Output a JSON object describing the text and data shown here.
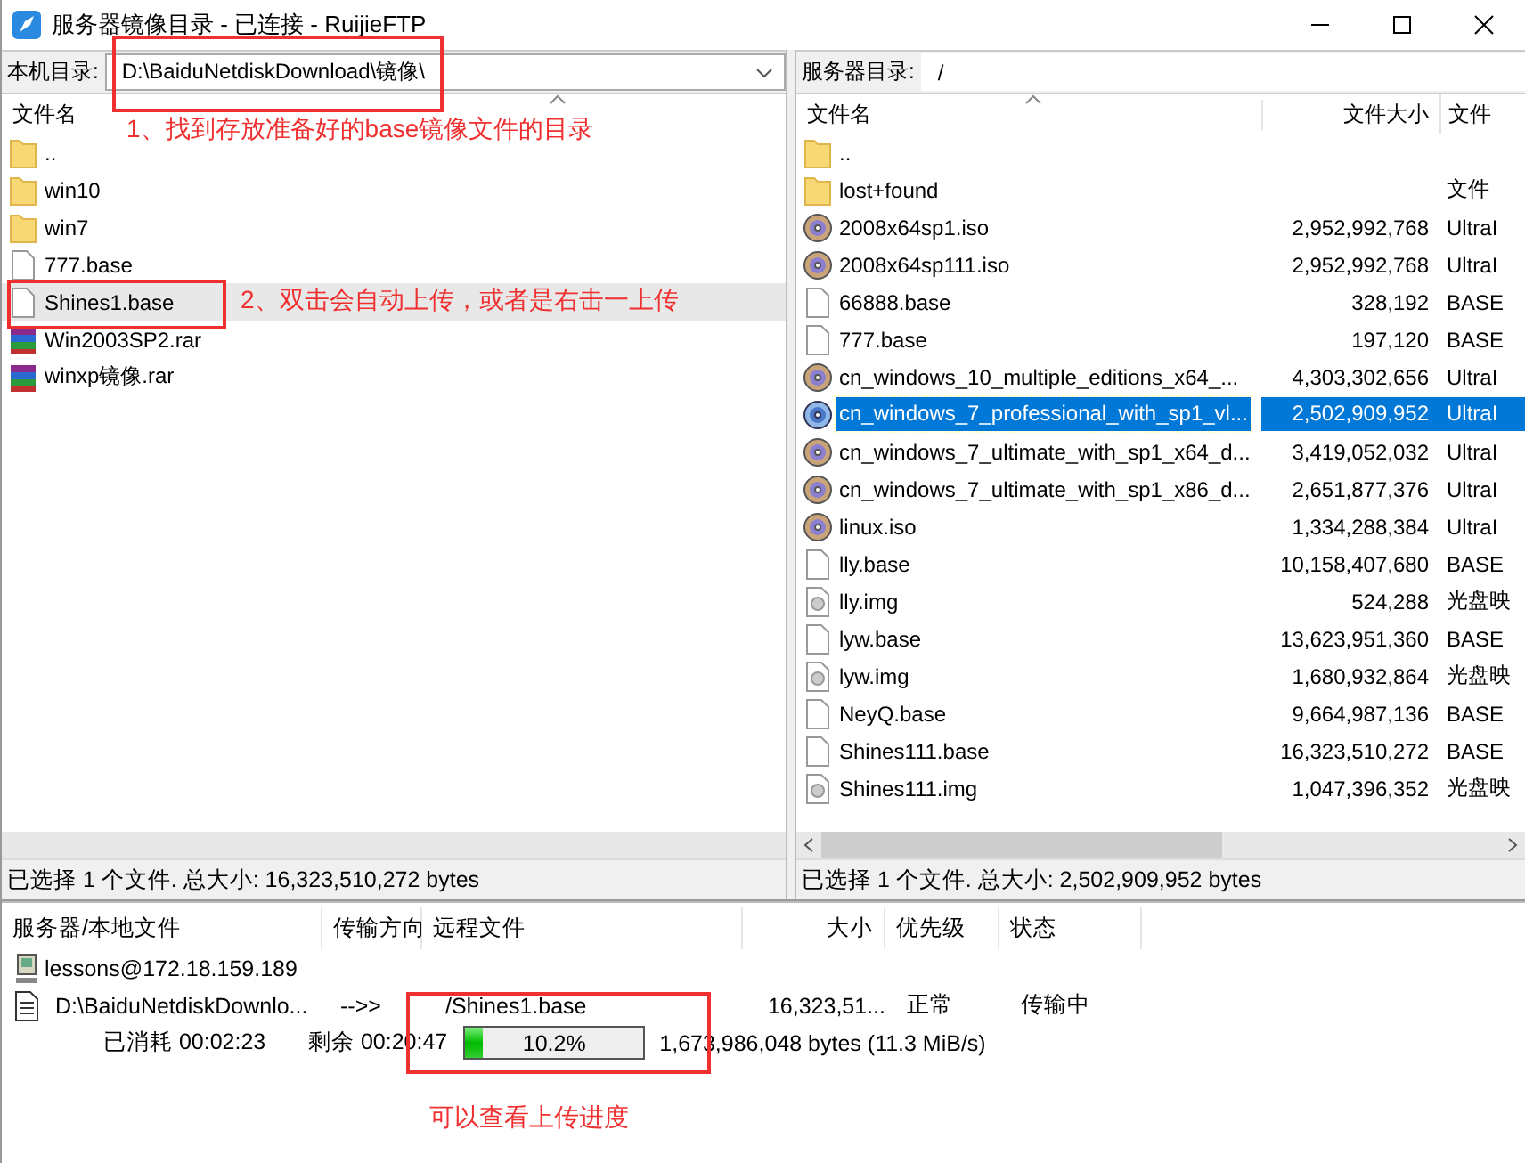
{
  "window": {
    "title": "服务器镜像目录 - 已连接 - RuijieFTP"
  },
  "local": {
    "path_label": "本机目录:",
    "path": "D:\\BaiduNetdiskDownload\\镜像\\",
    "columns": [
      "文件名"
    ],
    "files": [
      {
        "name": "..",
        "kind": "folder",
        "selected": false
      },
      {
        "name": "win10",
        "kind": "folder",
        "selected": false
      },
      {
        "name": "win7",
        "kind": "folder",
        "selected": false
      },
      {
        "name": "777.base",
        "kind": "file",
        "selected": false
      },
      {
        "name": "Shines1.base",
        "kind": "file",
        "selected": true
      },
      {
        "name": "Win2003SP2.rar",
        "kind": "archive",
        "selected": false
      },
      {
        "name": "winxp镜像.rar",
        "kind": "archive",
        "selected": false
      }
    ],
    "status": "已选择 1 个文件. 总大小: 16,323,510,272 bytes"
  },
  "remote": {
    "path_label": "服务器目录:",
    "path": "/",
    "columns": [
      "文件名",
      "文件大小",
      "文件"
    ],
    "files": [
      {
        "name": "..",
        "kind": "folder",
        "selected": false
      },
      {
        "name": "lost+found",
        "type": "文件",
        "kind": "folder",
        "selected": false
      },
      {
        "name": "2008x64sp1.iso",
        "size": "2,952,992,768",
        "type": "UltraI",
        "kind": "disc",
        "selected": false
      },
      {
        "name": "2008x64sp111.iso",
        "size": "2,952,992,768",
        "type": "UltraI",
        "kind": "disc",
        "selected": false
      },
      {
        "name": "66888.base",
        "size": "328,192",
        "type": "BASE",
        "kind": "file",
        "selected": false
      },
      {
        "name": "777.base",
        "size": "197,120",
        "type": "BASE",
        "kind": "file",
        "selected": false
      },
      {
        "name": "cn_windows_10_multiple_editions_x64_...",
        "size": "4,303,302,656",
        "type": "UltraI",
        "kind": "disc",
        "selected": false
      },
      {
        "name": "cn_windows_7_professional_with_sp1_vl...",
        "size": "2,502,909,952",
        "type": "UltraI",
        "kind": "disc",
        "selected": true
      },
      {
        "name": "cn_windows_7_ultimate_with_sp1_x64_d...",
        "size": "3,419,052,032",
        "type": "UltraI",
        "kind": "disc",
        "selected": false
      },
      {
        "name": "cn_windows_7_ultimate_with_sp1_x86_d...",
        "size": "2,651,877,376",
        "type": "UltraI",
        "kind": "disc",
        "selected": false
      },
      {
        "name": "linux.iso",
        "size": "1,334,288,384",
        "type": "UltraI",
        "kind": "disc",
        "selected": false
      },
      {
        "name": "lly.base",
        "size": "10,158,407,680",
        "type": "BASE",
        "kind": "file",
        "selected": false
      },
      {
        "name": "lly.img",
        "size": "524,288",
        "type": "光盘映",
        "kind": "image",
        "selected": false
      },
      {
        "name": "lyw.base",
        "size": "13,623,951,360",
        "type": "BASE",
        "kind": "file",
        "selected": false
      },
      {
        "name": "lyw.img",
        "size": "1,680,932,864",
        "type": "光盘映",
        "kind": "image",
        "selected": false
      },
      {
        "name": "NeyQ.base",
        "size": "9,664,987,136",
        "type": "BASE",
        "kind": "file",
        "selected": false
      },
      {
        "name": "Shines111.base",
        "size": "16,323,510,272",
        "type": "BASE",
        "kind": "file",
        "selected": false
      },
      {
        "name": "Shines111.img",
        "size": "1,047,396,352",
        "type": "光盘映",
        "kind": "image",
        "selected": false
      }
    ],
    "status": "已选择 1 个文件. 总大小: 2,502,909,952 bytes"
  },
  "queue": {
    "columns": [
      "服务器/本地文件",
      "传输方向",
      "远程文件",
      "大小",
      "优先级",
      "状态"
    ],
    "server": "lessons@172.18.159.189",
    "transfer": {
      "local": "D:\\BaiduNetdiskDownlo...",
      "direction": "-->>",
      "remote": "/Shines1.base",
      "size": "16,323,51...",
      "priority": "正常",
      "status": "传输中",
      "elapsed": "已消耗 00:02:23",
      "remaining": "剩余 00:20:47",
      "level": 0.102,
      "percent": "10.2%",
      "transferred": "1,673,986,048 bytes (11.3 MiB/s)"
    }
  },
  "annotations": [
    "1、找到存放准备好的base镜像文件的目录",
    "2、双击会自动上传，或者是右击一上传",
    "可以查看上传进度"
  ]
}
